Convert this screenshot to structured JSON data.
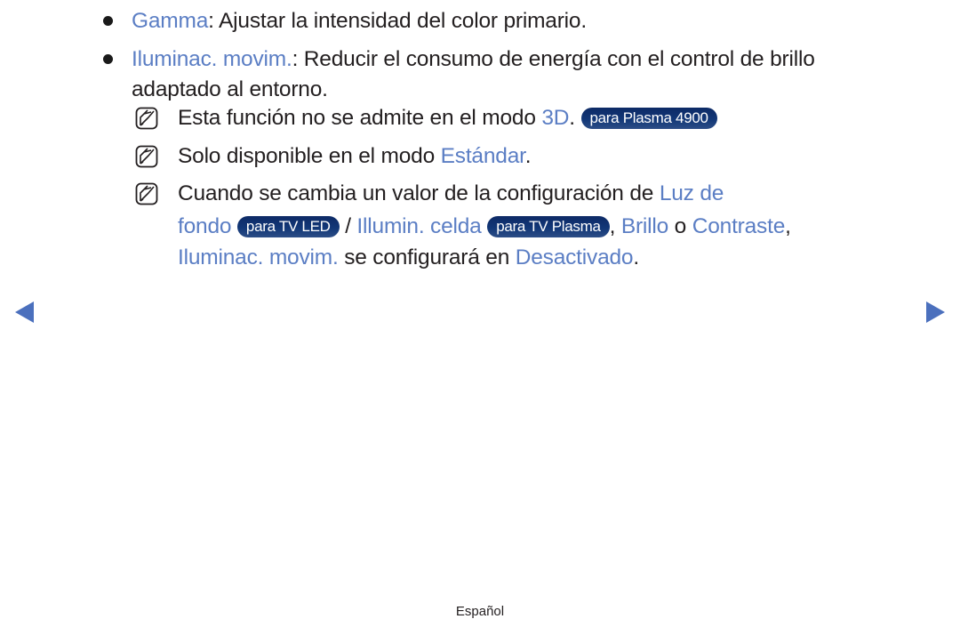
{
  "bullets": [
    {
      "term": "Gamma",
      "text": ": Ajustar la intensidad del color primario."
    },
    {
      "term": "Iluminac. movim.",
      "text": ": Reducir el consumo de energía con el control de brillo",
      "continuation": "adaptado al entorno."
    }
  ],
  "notes": [
    {
      "text_before": "Esta función no se admite en el modo ",
      "term": "3D",
      "text_after": ". ",
      "badge": "para Plasma 4900"
    },
    {
      "text_before": "Solo disponible en el modo ",
      "term": "Estándar",
      "text_after": "."
    },
    {
      "line1_text": "Cuando se cambia un valor de la configuración de ",
      "line1_term": "Luz de",
      "line2_term1": "fondo",
      "line2_badge1": "para TV LED",
      "line2_sep": " / ",
      "line2_term2": "Illumin. celda",
      "line2_badge2": "para TV Plasma",
      "line2_comma": ", ",
      "line2_term3": "Brillo",
      "line2_or": " o ",
      "line2_term4": "Contraste",
      "line2_end": ",",
      "line3_term1": "Iluminac. movim.",
      "line3_text": " se configurará en ",
      "line3_term2": "Desactivado",
      "line3_end": "."
    }
  ],
  "navigation": {
    "prev": "previous-page",
    "next": "next-page"
  },
  "footer": {
    "language": "Español"
  },
  "colors": {
    "keyword": "#5b7ec4",
    "badge": "#123777",
    "arrow": "#4b70bd"
  }
}
